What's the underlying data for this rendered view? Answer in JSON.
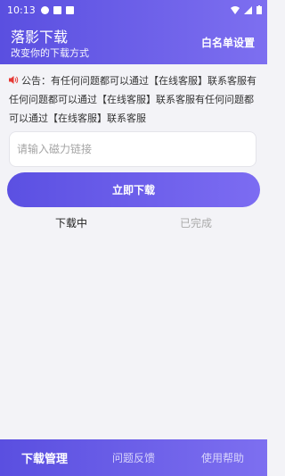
{
  "status_bar": {
    "time": "10:13"
  },
  "header": {
    "title": "落影下载",
    "subtitle": "改变你的下载方式",
    "whitelist_label": "白名单设置"
  },
  "notice": {
    "text": "公告：有任何问题都可以通过【在线客服】联系客服有任何问题都可以通过【在线客服】联系客服有任何问题都可以通过【在线客服】联系客服"
  },
  "magnet_input": {
    "placeholder": "请输入磁力链接",
    "value": ""
  },
  "download_button": {
    "label": "立即下载"
  },
  "tabs": [
    {
      "label": "下载中",
      "active": true
    },
    {
      "label": "已完成",
      "active": false
    }
  ],
  "bottom_nav": [
    {
      "label": "下载管理",
      "active": true
    },
    {
      "label": "问题反馈",
      "active": false
    },
    {
      "label": "使用帮助",
      "active": false
    }
  ],
  "colors": {
    "accent": "#6a5ee8",
    "notice_icon": "#e53935"
  }
}
